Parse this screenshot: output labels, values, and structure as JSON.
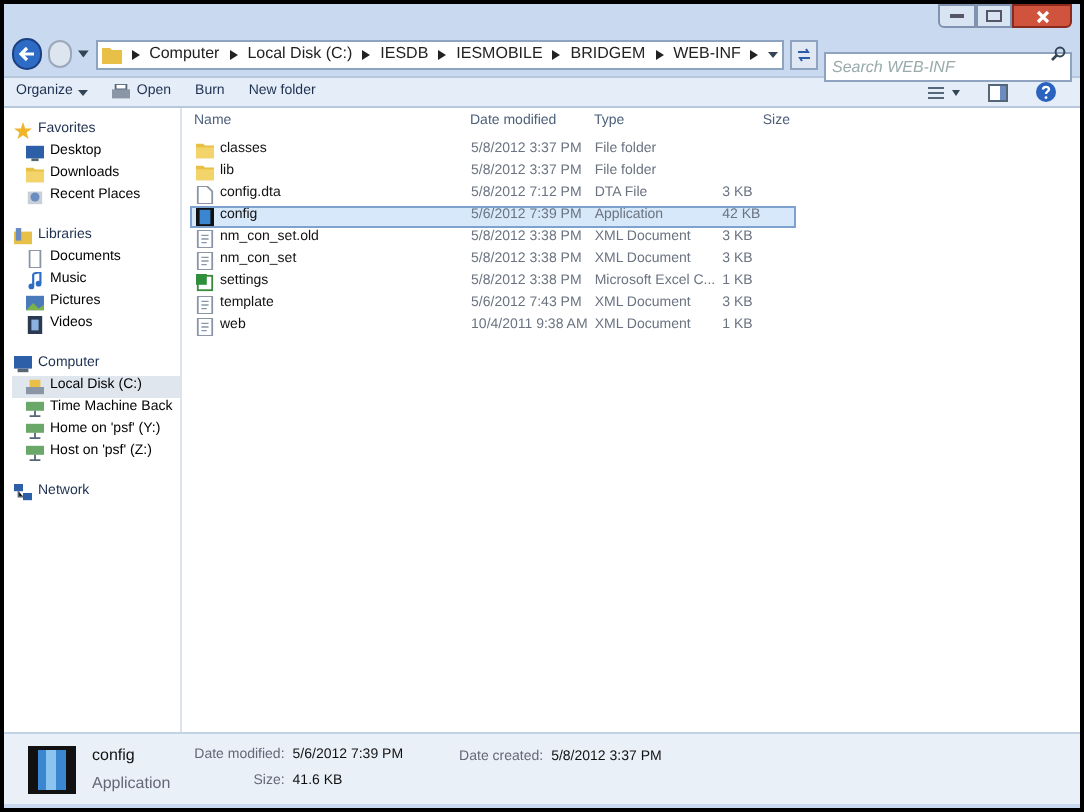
{
  "address_bar": {
    "crumbs": [
      "Computer",
      "Local Disk (C:)",
      "IESDB",
      "IESMOBILE",
      "BRIDGEM",
      "WEB-INF"
    ]
  },
  "search": {
    "placeholder": "Search WEB-INF"
  },
  "toolbar": {
    "buttons": [
      {
        "label": "Organize",
        "kind": "menu"
      },
      {
        "label": "Open",
        "kind": "open"
      },
      {
        "label": "Burn",
        "kind": "plain"
      },
      {
        "label": "New folder",
        "kind": "plain"
      }
    ]
  },
  "sidebar": {
    "groups": [
      {
        "label": "Favorites",
        "kind": "star",
        "items": [
          {
            "label": "Desktop",
            "kind": "desktop",
            "selected": false
          },
          {
            "label": "Downloads",
            "kind": "folder",
            "selected": false
          },
          {
            "label": "Recent Places",
            "kind": "recent",
            "selected": false
          }
        ]
      },
      {
        "label": "Libraries",
        "kind": "library",
        "items": [
          {
            "label": "Documents",
            "kind": "document",
            "selected": false
          },
          {
            "label": "Music",
            "kind": "music",
            "selected": false
          },
          {
            "label": "Pictures",
            "kind": "picture",
            "selected": false
          },
          {
            "label": "Videos",
            "kind": "video",
            "selected": false
          }
        ]
      },
      {
        "label": "Computer",
        "kind": "computer",
        "items": [
          {
            "label": "Local Disk (C:)",
            "kind": "disk",
            "selected": true
          },
          {
            "label": "Time Machine Back",
            "kind": "netdrive",
            "selected": false
          },
          {
            "label": "Home on 'psf' (Y:)",
            "kind": "netdrive",
            "selected": false
          },
          {
            "label": "Host on 'psf' (Z:)",
            "kind": "netdrive",
            "selected": false
          }
        ]
      },
      {
        "label": "Network",
        "kind": "network"
      }
    ]
  },
  "table": {
    "columns": [
      "Name",
      "Date modified",
      "Type",
      "Size"
    ],
    "rows": [
      {
        "kind": "folder",
        "selected": false,
        "cells": [
          "classes",
          "5/8/2012 3:37 PM",
          "File folder",
          ""
        ]
      },
      {
        "kind": "folder",
        "selected": false,
        "cells": [
          "lib",
          "5/8/2012 3:37 PM",
          "File folder",
          ""
        ]
      },
      {
        "kind": "file",
        "selected": false,
        "cells": [
          "config.dta",
          "5/8/2012 7:12 PM",
          "DTA File",
          "3 KB"
        ]
      },
      {
        "kind": "application",
        "selected": true,
        "cells": [
          "config",
          "5/6/2012 7:39 PM",
          "Application",
          "42 KB"
        ]
      },
      {
        "kind": "xml",
        "selected": false,
        "cells": [
          "nm_con_set.old",
          "5/8/2012 3:38 PM",
          "XML Document",
          "3 KB"
        ]
      },
      {
        "kind": "xml",
        "selected": false,
        "cells": [
          "nm_con_set",
          "5/8/2012 3:38 PM",
          "XML Document",
          "3 KB"
        ]
      },
      {
        "kind": "spreadsheet",
        "selected": false,
        "cells": [
          "settings",
          "5/8/2012 3:38 PM",
          "Microsoft Excel C...",
          "1 KB"
        ]
      },
      {
        "kind": "xml",
        "selected": false,
        "cells": [
          "template",
          "5/6/2012 7:43 PM",
          "XML Document",
          "3 KB"
        ]
      },
      {
        "kind": "xml",
        "selected": false,
        "cells": [
          "web",
          "10/4/2011 9:38 AM",
          "XML Document",
          "1 KB"
        ]
      }
    ]
  },
  "details": {
    "name": "config",
    "type": "Application",
    "fields": [
      {
        "label": "Date modified:",
        "value": "5/6/2012 7:39 PM"
      },
      {
        "label": "Size:",
        "value": "41.6 KB"
      },
      {
        "label": "Date created:",
        "value": "5/8/2012 3:37 PM"
      }
    ]
  }
}
